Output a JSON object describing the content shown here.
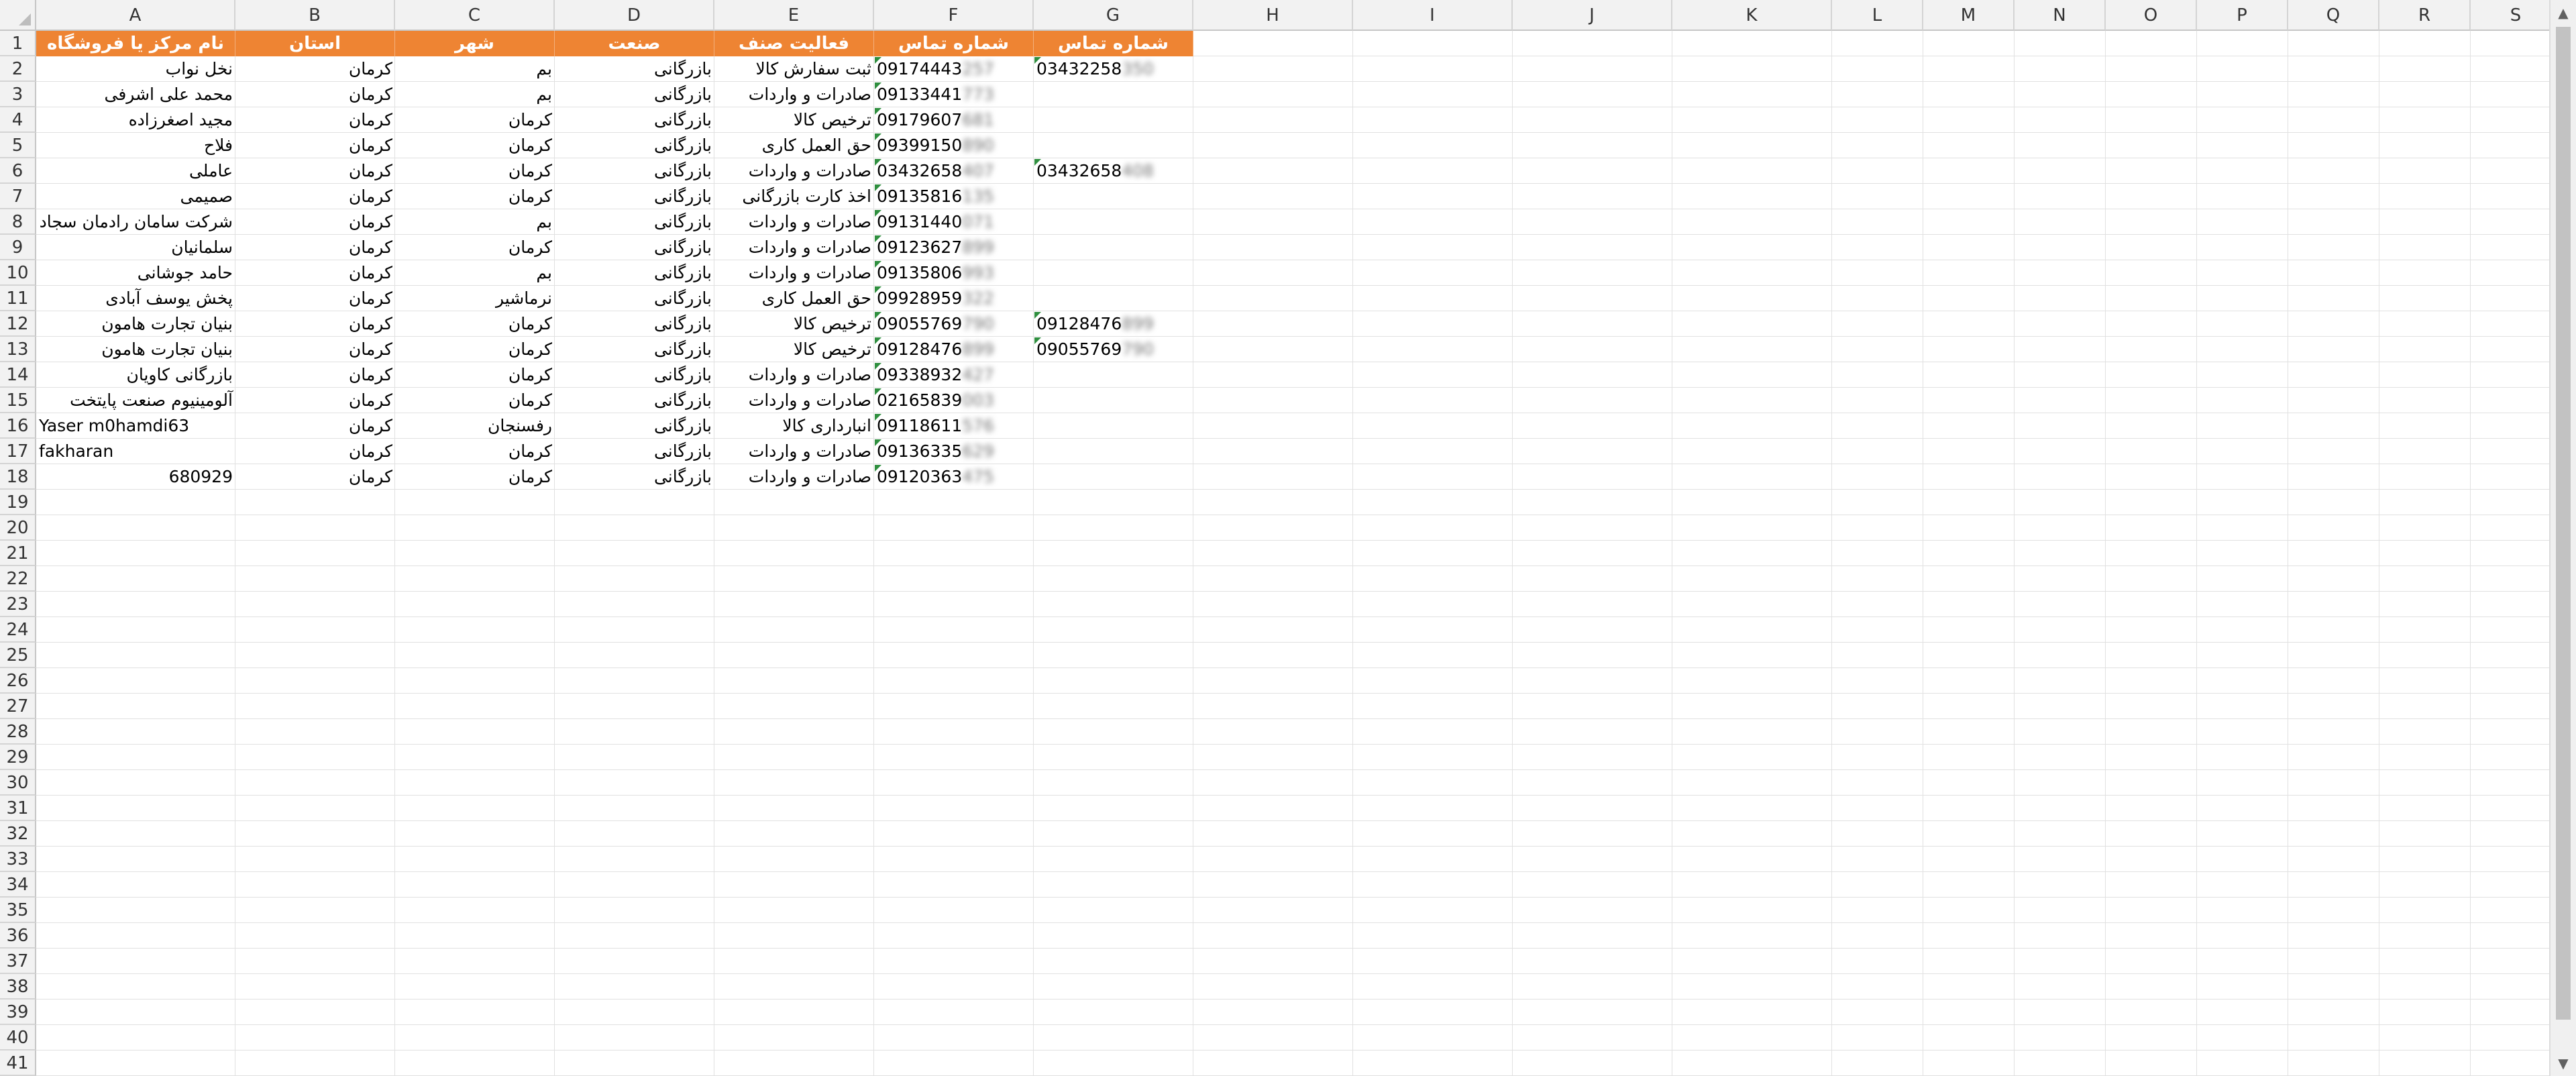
{
  "columns": [
    "A",
    "B",
    "C",
    "D",
    "E",
    "F",
    "G",
    "H",
    "I",
    "J",
    "K",
    "L",
    "M",
    "N",
    "O",
    "P",
    "Q",
    "R",
    "S"
  ],
  "rows": [
    "1",
    "2",
    "3",
    "4",
    "5",
    "6",
    "7",
    "8",
    "9",
    "10",
    "11",
    "12",
    "13",
    "14",
    "15",
    "16",
    "17",
    "18",
    "19",
    "20",
    "21",
    "22",
    "23",
    "24",
    "25",
    "26",
    "27",
    "28",
    "29",
    "30",
    "31",
    "32",
    "33",
    "34",
    "35",
    "36",
    "37",
    "38",
    "39",
    "40",
    "41"
  ],
  "header": [
    "نام مرکز یا فروشگاه",
    "استان",
    "شهر",
    "صنعت",
    "فعالیت صنف",
    "شماره تماس",
    "شماره تماس"
  ],
  "table": [
    {
      "name": "نخل نواب",
      "province": "کرمان",
      "city": "بم",
      "industry": "بازرگانی",
      "activity": "ثبت سفارش کالا",
      "phone": "09174443",
      "phone_hidden": "257",
      "phone2": "03432258",
      "phone2_hidden": "350"
    },
    {
      "name": "محمد علی اشرفی",
      "province": "کرمان",
      "city": "بم",
      "industry": "بازرگانی",
      "activity": "صادرات و واردات",
      "phone": "09133441",
      "phone_hidden": "773",
      "phone2": "",
      "phone2_hidden": ""
    },
    {
      "name": "مجید اصغرزاده",
      "province": "کرمان",
      "city": "کرمان",
      "industry": "بازرگانی",
      "activity": "ترخیص کالا",
      "phone": "09179607",
      "phone_hidden": "681",
      "phone2": "",
      "phone2_hidden": ""
    },
    {
      "name": "فلاح",
      "province": "کرمان",
      "city": "کرمان",
      "industry": "بازرگانی",
      "activity": "حق العمل کاری",
      "phone": "09399150",
      "phone_hidden": "890",
      "phone2": "",
      "phone2_hidden": ""
    },
    {
      "name": "عاملی",
      "province": "کرمان",
      "city": "کرمان",
      "industry": "بازرگانی",
      "activity": "صادرات و واردات",
      "phone": "03432658",
      "phone_hidden": "407",
      "phone2": "03432658",
      "phone2_hidden": "408"
    },
    {
      "name": "صمیمی",
      "province": "کرمان",
      "city": "کرمان",
      "industry": "بازرگانی",
      "activity": "اخذ کارت بازرگانی",
      "phone": "09135816",
      "phone_hidden": "135",
      "phone2": "",
      "phone2_hidden": ""
    },
    {
      "name": "شرکت سامان رادمان سجاد",
      "province": "کرمان",
      "city": "بم",
      "industry": "بازرگانی",
      "activity": "صادرات و واردات",
      "phone": "09131440",
      "phone_hidden": "071",
      "phone2": "",
      "phone2_hidden": ""
    },
    {
      "name": "سلمانیان",
      "province": "کرمان",
      "city": "کرمان",
      "industry": "بازرگانی",
      "activity": "صادرات و واردات",
      "phone": "09123627",
      "phone_hidden": "899",
      "phone2": "",
      "phone2_hidden": ""
    },
    {
      "name": "حامد جوشانی",
      "province": "کرمان",
      "city": "بم",
      "industry": "بازرگانی",
      "activity": "صادرات و واردات",
      "phone": "09135806",
      "phone_hidden": "993",
      "phone2": "",
      "phone2_hidden": ""
    },
    {
      "name": "پخش یوسف آبادی",
      "province": "کرمان",
      "city": "نرماشیر",
      "industry": "بازرگانی",
      "activity": "حق العمل کاری",
      "phone": "09928959",
      "phone_hidden": "322",
      "phone2": "",
      "phone2_hidden": ""
    },
    {
      "name": "بنیان تجارت هامون",
      "province": "کرمان",
      "city": "کرمان",
      "industry": "بازرگانی",
      "activity": "ترخیص کالا",
      "phone": "09055769",
      "phone_hidden": "790",
      "phone2": "09128476",
      "phone2_hidden": "899"
    },
    {
      "name": "بنیان تجارت هامون",
      "province": "کرمان",
      "city": "کرمان",
      "industry": "بازرگانی",
      "activity": "ترخیص کالا",
      "phone": "09128476",
      "phone_hidden": "899",
      "phone2": "09055769",
      "phone2_hidden": "790"
    },
    {
      "name": "بازرگانی کاویان",
      "province": "کرمان",
      "city": "کرمان",
      "industry": "بازرگانی",
      "activity": "صادرات و واردات",
      "phone": "09338932",
      "phone_hidden": "427",
      "phone2": "",
      "phone2_hidden": ""
    },
    {
      "name": "آلومینیوم صنعت پایتخت",
      "province": "کرمان",
      "city": "کرمان",
      "industry": "بازرگانی",
      "activity": "صادرات و واردات",
      "phone": "02165839",
      "phone_hidden": "003",
      "phone2": "",
      "phone2_hidden": ""
    },
    {
      "name": "Yaser m0hamdi63",
      "province": "کرمان",
      "city": "رفسنجان",
      "industry": "بازرگانی",
      "activity": "انبارداری کالا",
      "phone": "09118611",
      "phone_hidden": "576",
      "phone2": "",
      "phone2_hidden": ""
    },
    {
      "name": "fakharan",
      "province": "کرمان",
      "city": "کرمان",
      "industry": "بازرگانی",
      "activity": "صادرات و واردات",
      "phone": "09136335",
      "phone_hidden": "629",
      "phone2": "",
      "phone2_hidden": ""
    },
    {
      "name": "680929",
      "province": "کرمان",
      "city": "کرمان",
      "industry": "بازرگانی",
      "activity": "صادرات و واردات",
      "phone": "09120363",
      "phone_hidden": "475",
      "phone2": "",
      "phone2_hidden": ""
    }
  ],
  "scrollbar": {
    "up_icon": "chevron-up-icon",
    "down_icon": "chevron-down-icon"
  },
  "colors": {
    "header_bg": "#ee8433",
    "header_text": "#ffffff",
    "error_triangle": "#2f8f3f"
  }
}
